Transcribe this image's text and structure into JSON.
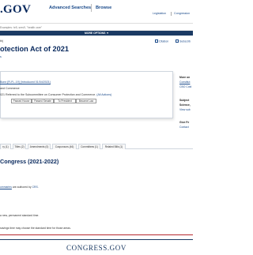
{
  "header": {
    "logo_text": ".GOV",
    "nav": {
      "advanced_searches": "Advanced Searches",
      "browse": "Browse"
    },
    "util": {
      "legislation": "Legislation",
      "congressional": "Congression"
    }
  },
  "search": {
    "placeholder": "Examples: hr5, sres9, \"health care\""
  },
  "options": {
    "label": "MORE OPTIONS ▼"
  },
  "bill": {
    "meta_small": "th)",
    "title": "otection Act of 2021",
    "actions": {
      "citation": "Citation",
      "subscribe": "Subscrib"
    },
    "sub_small": "s",
    "sponsor_line": "Bonn [R-FL-19] (Introduced 01/04/2021)",
    "committee_line": "and Commerce",
    "action_line": "021 Referred to the Subcommittee on Consumer Protection and Commerce.",
    "all_actions": "(All Actions)",
    "tags": [
      "Passed House",
      "Passed Senate",
      "To President",
      "Became Law"
    ]
  },
  "sidebar": {
    "more_on": "More on",
    "constitutional": "Constitut",
    "cbo": "CBO Cost",
    "subject": "Subject",
    "science": "Science,",
    "view_subjects": "View sub",
    "give_feedback": "Give Fe",
    "contact": "Contact"
  },
  "tabs": [
    "ry (1)",
    "Titles (2)",
    "Amendments (0)",
    "Cosponsors (46)",
    "Committees (1)",
    "Related Bills (1)"
  ],
  "summary": {
    "section_title": "Congress (2021-2022)",
    "crs_line_link": "ummaries",
    "crs_line_rest": "are authored by",
    "crs_link": "CRS",
    "line1": "a new, permanent standard time.",
    "line2": "savings time may choose the standard time for those areas."
  },
  "footer": {
    "logo_text": "CONGRESS.GOV"
  },
  "colors": {
    "navy": "#0a2a5e",
    "link": "#1a4a8a",
    "bar": "#1b3a63",
    "accent_red": "#b5282e"
  }
}
